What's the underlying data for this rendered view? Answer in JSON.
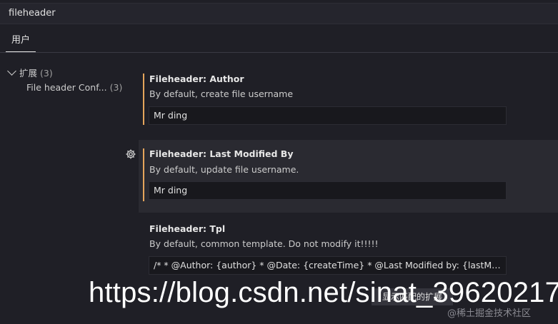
{
  "search": {
    "value": "fileheader"
  },
  "tabs": [
    {
      "label": "用户"
    }
  ],
  "tree": {
    "group": {
      "label": "扩展",
      "count": "(3)"
    },
    "item": {
      "label": "File header Conf...",
      "count": "(3)"
    }
  },
  "settings": [
    {
      "title": "Fileheader: Author",
      "description": "By default, create file username",
      "value": "Mr ding"
    },
    {
      "title": "Fileheader: Last Modified By",
      "description": "By default, update file username.",
      "value": "Mr ding"
    },
    {
      "title": "Fileheader: Tpl",
      "description": "By default, common template. Do not modify it!!!!!",
      "value": "/* * @Author: {author}  * @Date: {createTime}  * @Last Modified by:   {lastModifiedB..."
    }
  ],
  "more_button": {
    "label": "显示匹配的扩展"
  },
  "watermark": {
    "url": "https://blog.csdn.net/sinat_39620217",
    "sub": "@稀土掘金技术社区"
  },
  "colors": {
    "accent": "#e5a55c",
    "background": "#1f1f26"
  },
  "icons": {
    "setting_gear": "gear-icon",
    "tree_toggle": "chevron-down-icon"
  }
}
